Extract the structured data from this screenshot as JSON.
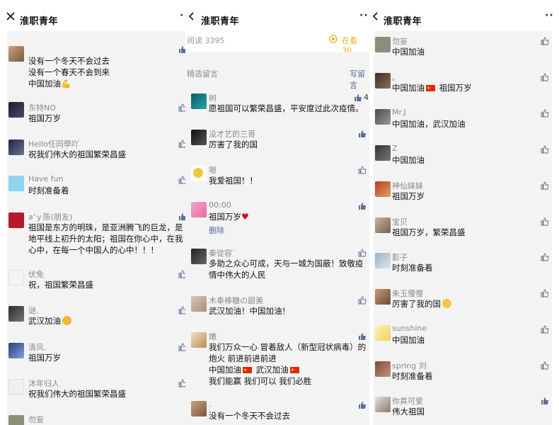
{
  "colors": {
    "accent_gold": "#e6b421",
    "link_blue": "#576b95",
    "like_blue": "#5b6e95",
    "bg_gray": "#f3f3f3"
  },
  "panel1": {
    "title": "淮职青年",
    "more": "··",
    "first_comment_lines": [
      "没有一个冬天不会过去",
      "没有一个春天不会到来",
      "中国加油💪"
    ],
    "comments": [
      {
        "name": "东特NO",
        "text": "祖国万岁"
      },
      {
        "name": "Hello任同學吖",
        "text": "祝我们伟大的祖国繁荣昌盛"
      },
      {
        "name": "Have fun",
        "text": "时刻准备着"
      },
      {
        "name": "a'ｙ陈(朋友)",
        "lines": [
          "祖国是东方的明珠，是亚洲腾飞的巨龙，是",
          "地平线上初升的太阳；祖国在你心中，在我",
          "心中，在每一个中国人的心中！！！"
        ]
      },
      {
        "name": "伏免",
        "text": "祝，祖国繁荣昌盛"
      },
      {
        "name": "谜.",
        "text": "武汉加油"
      },
      {
        "name": "清风.",
        "text": "祖国万岁"
      },
      {
        "name": "沐年归人",
        "text": "祝我们伟大的祖国繁荣昌盛"
      },
      {
        "name": "勿妄",
        "text": ""
      }
    ]
  },
  "panel2": {
    "title": "淮职青年",
    "more": "··",
    "read_label": "阅读 3395",
    "watching_label": "在看 30",
    "selected_comments": "精选留言",
    "write_comment": "写留言",
    "comments": [
      {
        "name": "树",
        "text": "愿祖国可以繁荣昌盛，平安度过此次疫情。",
        "likes": "4"
      },
      {
        "name": "没才艺的三哥",
        "text": "厉害了我的国"
      },
      {
        "name": "嗯",
        "text": "我爱祖国！！"
      },
      {
        "name": "00:00",
        "text": "祖国万岁",
        "delete": "删除"
      },
      {
        "name": "秦從容`",
        "lines": [
          "多助之众心可成，天与一城为国蔽！致敬疫",
          "情中伟大的人民"
        ]
      },
      {
        "name": "木奉棒糖の甜美",
        "text": "武汉加油！中国加油！"
      },
      {
        "name": "嫩",
        "lines": [
          "我们万众一心  冒着敌人（新型冠状病毒）的",
          "炮火  前进前进前进",
          "中国加油",
          "我们能赢  我们可以  我们必胜"
        ],
        "flag_line_tail": "武汉加油"
      },
      {
        "name": ".",
        "text": "没有一个冬天不会过去"
      }
    ]
  },
  "panel3": {
    "title": "淮职青年",
    "more": "··",
    "comments": [
      {
        "name": "勿妄",
        "text": "中国加油"
      },
      {
        "name": "。",
        "text": "中国加油",
        "tail": "祖国万岁"
      },
      {
        "name": "Mr.J",
        "text": "中国加油，武汉加油"
      },
      {
        "name": "Z",
        "text": "中国加油"
      },
      {
        "name": "神仙妹妹",
        "text": "祖国万岁"
      },
      {
        "name": "宝贝",
        "text": "祖国万岁，繁荣昌盛"
      },
      {
        "name": "影子",
        "text": "时刻准备着"
      },
      {
        "name": "朱玉慢慢",
        "text": "厉害了我的国"
      },
      {
        "name": "sunshine",
        "text": "中国加油"
      },
      {
        "name": "spring 刘",
        "text": "时刻准备着"
      },
      {
        "name": "你真可爱",
        "text": "伟大祖国"
      }
    ]
  }
}
